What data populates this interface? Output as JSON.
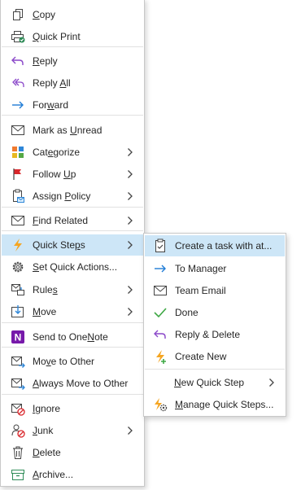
{
  "main_menu": {
    "items": [
      {
        "key": "copy",
        "pre": "",
        "ul": "C",
        "post": "opy",
        "icon": "copy-icon"
      },
      {
        "key": "quick_print",
        "pre": "",
        "ul": "Q",
        "post": "uick Print",
        "icon": "quick-print-icon"
      },
      {
        "key": "reply",
        "pre": "",
        "ul": "R",
        "post": "eply",
        "icon": "reply-icon"
      },
      {
        "key": "reply_all",
        "pre": "Reply ",
        "ul": "A",
        "post": "ll",
        "icon": "reply-all-icon"
      },
      {
        "key": "forward",
        "pre": "For",
        "ul": "w",
        "post": "ard",
        "icon": "forward-icon"
      },
      {
        "key": "mark_unread",
        "pre": "Mark as ",
        "ul": "U",
        "post": "nread",
        "icon": "envelope-icon"
      },
      {
        "key": "categorize",
        "pre": "Cat",
        "ul": "e",
        "post": "gorize",
        "icon": "categorize-icon"
      },
      {
        "key": "follow_up",
        "pre": "Follow ",
        "ul": "U",
        "post": "p",
        "icon": "flag-icon"
      },
      {
        "key": "assign_policy",
        "pre": "Assign ",
        "ul": "P",
        "post": "olicy",
        "icon": "assign-policy-icon"
      },
      {
        "key": "find_related",
        "pre": "",
        "ul": "F",
        "post": "ind Related",
        "icon": "find-related-icon"
      },
      {
        "key": "quick_steps",
        "pre": "Quick Ste",
        "ul": "p",
        "post": "s",
        "icon": "quick-steps-icon"
      },
      {
        "key": "set_quick_actions",
        "pre": "",
        "ul": "S",
        "post": "et Quick Actions...",
        "icon": "gear-icon"
      },
      {
        "key": "rules",
        "pre": "Rule",
        "ul": "s",
        "post": "",
        "icon": "rules-icon"
      },
      {
        "key": "move",
        "pre": "",
        "ul": "M",
        "post": "ove",
        "icon": "move-icon"
      },
      {
        "key": "send_onenote",
        "pre": "Send to One",
        "ul": "N",
        "post": "ote",
        "icon": "onenote-icon"
      },
      {
        "key": "move_to_other",
        "pre": "Mo",
        "ul": "v",
        "post": "e to Other",
        "icon": "move-to-other-icon"
      },
      {
        "key": "always_move",
        "pre": "",
        "ul": "A",
        "post": "lways Move to Other",
        "icon": "always-move-icon"
      },
      {
        "key": "ignore",
        "pre": "",
        "ul": "I",
        "post": "gnore",
        "icon": "ignore-icon"
      },
      {
        "key": "junk",
        "pre": "",
        "ul": "J",
        "post": "unk",
        "icon": "junk-icon"
      },
      {
        "key": "delete",
        "pre": "",
        "ul": "D",
        "post": "elete",
        "icon": "trash-icon"
      },
      {
        "key": "archive",
        "pre": "",
        "ul": "A",
        "post": "rchive...",
        "icon": "archive-icon"
      }
    ]
  },
  "quick_steps_menu": {
    "items": [
      {
        "key": "create_task",
        "label": "Create a task with at...",
        "icon": "task-clipboard-icon"
      },
      {
        "key": "to_manager",
        "label": "To Manager",
        "icon": "arrow-right-icon"
      },
      {
        "key": "team_email",
        "label": "Team Email",
        "icon": "envelope-icon"
      },
      {
        "key": "done",
        "label": "Done",
        "icon": "checkmark-icon"
      },
      {
        "key": "reply_delete",
        "label": "Reply & Delete",
        "icon": "reply-icon"
      },
      {
        "key": "create_new",
        "label": "Create New",
        "icon": "lightning-icon"
      },
      {
        "key": "new_quick_step",
        "pre": "",
        "ul": "N",
        "post": "ew Quick Step",
        "icon": ""
      },
      {
        "key": "manage_quick_steps",
        "pre": "",
        "ul": "M",
        "post": "anage Quick Steps...",
        "icon": "manage-quick-steps-icon"
      }
    ]
  }
}
